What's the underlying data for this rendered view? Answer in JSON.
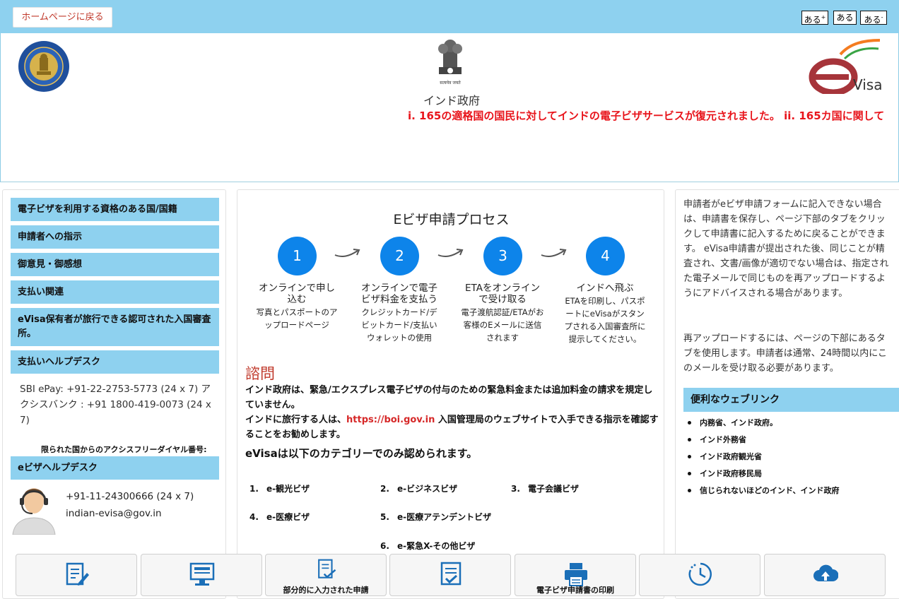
{
  "topbar": {
    "home_label": "ホームページに戻る",
    "font_increase": "ある",
    "font_increase_sup": "+",
    "font_normal": "ある",
    "font_decrease": "ある",
    "font_decrease_sup": "-"
  },
  "header": {
    "emblem_motto": "सत्यमेव जयते",
    "gov_name": "インド政府",
    "marquee": "i. 165の適格国の国民に対してインドの電子ビザサービスが復元されました。 ii. 165カ国に関して"
  },
  "left_menu": {
    "items": [
      {
        "label": "電子ビザを利用する資格のある国/国籍"
      },
      {
        "label": "申請者への指示"
      },
      {
        "label": "御意見・御感想"
      },
      {
        "label": "支払い関連"
      },
      {
        "label": "eVisa保有者が旅行できる認可された入国審査所。"
      },
      {
        "label": "支払いヘルプデスク"
      }
    ],
    "payment_contact": "SBI ePay: +91-22-2753-5773 (24 x 7) アクシスバンク : +91 1800-419-0073 (24 x 7)",
    "tollfree": "限られた国からのアクシスフリーダイヤル番号:",
    "helpdesk_title": "eビザヘルプデスク",
    "helpdesk_phone": "+91-11-24300666 (24 x 7)",
    "helpdesk_email": "indian-evisa@gov.in"
  },
  "process": {
    "title": "Eビザ申請プロセス",
    "steps": [
      {
        "num": "1",
        "title": "オンラインで申し込む",
        "desc": "写真とパスポートのアップロードページ"
      },
      {
        "num": "2",
        "title": "オンラインで電子ビザ料金を支払う",
        "desc": "クレジットカード/デビットカード/支払いウォレットの使用"
      },
      {
        "num": "3",
        "title": "ETAをオンラインで受け取る",
        "desc": "電子渡航認証/ETAがお客様のEメールに送信されます"
      },
      {
        "num": "4",
        "title": "インドへ飛ぶ",
        "desc": "ETAを印刷し、パスポートにeVisaがスタンプされる入国審査所に提示してください。"
      }
    ]
  },
  "notice": {
    "heading": "諮問",
    "para1": "インド政府は、緊急/エクスプレス電子ビザの付与のための緊急料金または追加料金の請求を規定していません。",
    "para2_pre": "インドに旅行する人は、",
    "para2_link": "https://boi.gov.in",
    "para2_post": " 入国管理局のウェブサイトで入手できる指示を確認することをお勧めします。",
    "categories_title": "eVisaは以下のカテゴリーでのみ認められます。",
    "categories": [
      {
        "num": "1.",
        "label": "e-観光ビザ"
      },
      {
        "num": "2.",
        "label": "e-ビジネスビザ"
      },
      {
        "num": "3.",
        "label": "電子会議ビザ"
      },
      {
        "num": "4.",
        "label": "e-医療ビザ"
      },
      {
        "num": "5.",
        "label": "e-医療アテンデントビザ"
      },
      {
        "num": "6.",
        "label": "e-緊急X-その他ビザ"
      }
    ]
  },
  "right_panel": {
    "text1": "申請者がeビザ申請フォームに記入できない場合は、申請書を保存し、ページ下部のタブをクリックして申請書に記入するために戻ることができます。 eVisa申請書が提出された後、同じことが精査され、文書/画像が適切でない場合は、指定された電子メールで同じものを再アップロードするようにアドバイスされる場合があります。",
    "text2": "再アップロードするには、ページの下部にあるタブを使用します。申請者は通常、24時間以内にこのメールを受け取る必要があります。",
    "links_title": "便利なウェブリンク",
    "links": [
      {
        "label": "内務省、インド政府。"
      },
      {
        "label": "インド外務省"
      },
      {
        "label": "インド政府観光省"
      },
      {
        "label": "インド政府移民局"
      },
      {
        "label": "信じられないほどのインド、インド政府"
      }
    ]
  },
  "bottom_tabs": {
    "tab3_caption": "部分的に入力された申請",
    "tab5_caption": "電子ビザ申請書の印刷"
  }
}
